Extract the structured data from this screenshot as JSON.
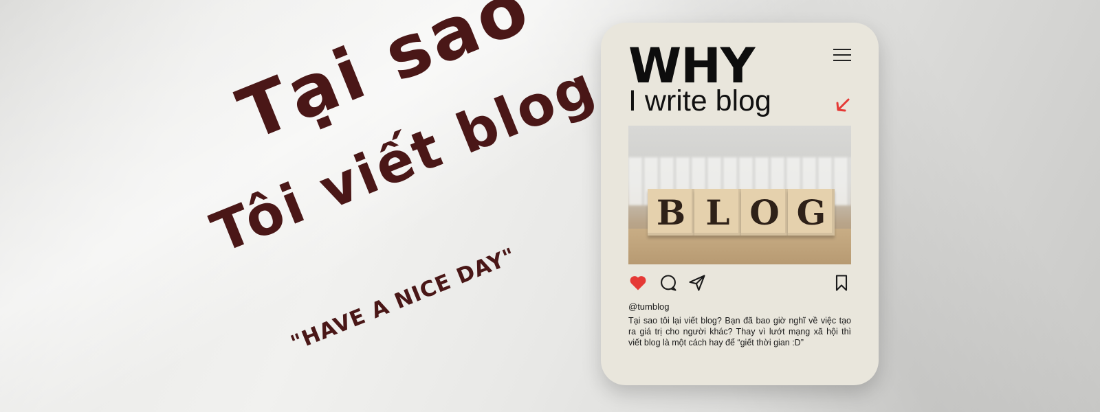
{
  "headline": {
    "line1": "Tại sao",
    "line2": "Tôi viết blog ?"
  },
  "tagline": "\"HAVE A NICE DAY\"",
  "card": {
    "title": "WHY",
    "subtitle": "I write blog",
    "photo_blocks": [
      "B",
      "L",
      "O",
      "G"
    ],
    "handle": "@tumblog",
    "caption": "Tại sao tôi lại viết blog? Bạn đã bao giờ nghĩ về việc tạo ra giá trị cho người khác? Thay vì lướt mạng xã hội thì viết blog là một cách hay để “giết thời gian :D”",
    "icons": {
      "menu": "menu-icon",
      "arrow": "arrow-down-left-icon",
      "like": "heart-icon",
      "comment": "comment-icon",
      "share": "send-icon",
      "save": "bookmark-icon"
    }
  },
  "colors": {
    "headline": "#4a1717",
    "card_bg": "#e9e6dc",
    "like": "#e53935",
    "arrow": "#e53935"
  }
}
